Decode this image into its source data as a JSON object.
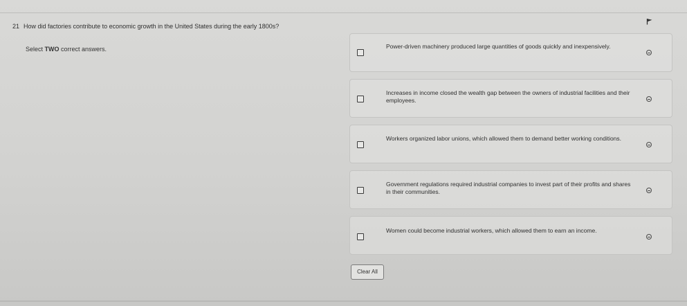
{
  "question": {
    "number": "21",
    "text": "How did factories contribute to economic growth in the United States during the early 1800s?"
  },
  "instruction": {
    "prefix": "Select ",
    "emphasis": "TWO",
    "suffix": " correct answers."
  },
  "options": [
    {
      "text": "Power-driven machinery produced large quantities of goods quickly and inexpensively."
    },
    {
      "text": "Increases in income closed the wealth gap between the owners of industrial facilities and their employees."
    },
    {
      "text": "Workers organized labor unions, which allowed them to demand better working conditions."
    },
    {
      "text": "Government regulations required industrial companies to invest part of their profits and shares in their communities."
    },
    {
      "text": "Women could become industrial workers, which allowed them to earn an income."
    }
  ],
  "controls": {
    "clear_all_label": "Clear All"
  },
  "icons": {
    "flag": "flag-icon",
    "option_checkbox": "checkbox-icon",
    "eliminate": "eliminate-option-icon"
  }
}
